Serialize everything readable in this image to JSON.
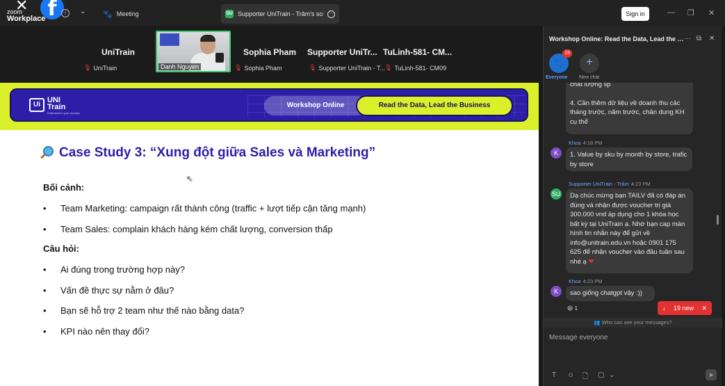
{
  "app": {
    "logo_line1": "zoom",
    "logo_line2": "Workplace"
  },
  "topbar": {
    "meeting_tab": "Meeting",
    "share_badge": "SU",
    "share_tab": "Supporter UniTrain - Trâm's screen",
    "signin": "Sign in"
  },
  "participants": [
    {
      "name": "UniTrain",
      "sub": "UniTrain"
    },
    {
      "name": "Danh Nguyen"
    },
    {
      "name": "Sophia Pham",
      "sub": "Sophia Pham"
    },
    {
      "name": "Supporter UniTr...",
      "sub": "Supporter UniTrain - T..."
    },
    {
      "name": "TuLinh-581-  CM...",
      "sub": "TuLinh-581- CM09"
    }
  ],
  "slide": {
    "brand_name": "UNI Train",
    "brand_tag": "Dedicated to your success",
    "pill_workshop": "Workshop Online",
    "pill_topic": "Read the Data, Lead the Business",
    "title": "Case Study 3: “Xung đột giữa Sales và Marketing”",
    "context_heading": "Bối cảnh:",
    "context_items": [
      "Team Marketing: campaign rất thành công (traffic + lượt tiếp cận tăng mạnh)",
      "Team Sales: complain khách hàng kém chất lượng, conversion thấp"
    ],
    "question_heading": "Câu hỏi:",
    "question_items": [
      "Ai đúng trong trường hợp này?",
      "Vấn đề thực sự nằm ở đâu?",
      "Bạn sẽ  hỗ trợ 2 team như thế nào bằng data?",
      "KPI nào nên thay đổi?"
    ]
  },
  "chat": {
    "title": "Workshop Online: Read the Data, Lead the B...",
    "everyone_label": "Everyone",
    "everyone_badge": "19",
    "new_chat_label": "New chat",
    "messages": [
      {
        "text_top": "chất lượng sp"
      },
      {
        "text": "4. Cần thêm dữ liệu về doanh thu các tháng trước, năm trước, chân dung KH cụ thể"
      },
      {
        "avatar": "K",
        "sender": "Khoa",
        "time": "4:18 PM",
        "text": "1. Value by sku by month by store, trafic by store"
      },
      {
        "avatar": "SU",
        "sender": "Supporter UniTrain - Trâm",
        "time": "4:23 PM",
        "text": "Dạ chúc mừng bạn TAILV đã có đáp án đúng và nhận được voucher trị giá 300.000 vnd áp dụng cho 1 khóa học bất kỳ tại UniTrain ạ. Nhờ bạn cap màn hình tin nhắn này để gửi về info@unitrain.edu.vn hoặc 0901 175 625 để nhận voucher vào đầu tuần sau nhé ạ"
      },
      {
        "avatar": "K",
        "sender": "Khoa",
        "time": "4:23 PM",
        "text": "sao giống chatgpt vậy :))"
      }
    ],
    "reaction_count": "1",
    "new_messages": "19 new",
    "who_can_see": "Who can see your messages?",
    "compose_placeholder": "Message everyone"
  },
  "colors": {
    "accent_lime": "#d9f02a",
    "brand_indigo": "#2d1ea8",
    "zoom_blue": "#1f6fd0",
    "alert_red": "#e33232"
  }
}
